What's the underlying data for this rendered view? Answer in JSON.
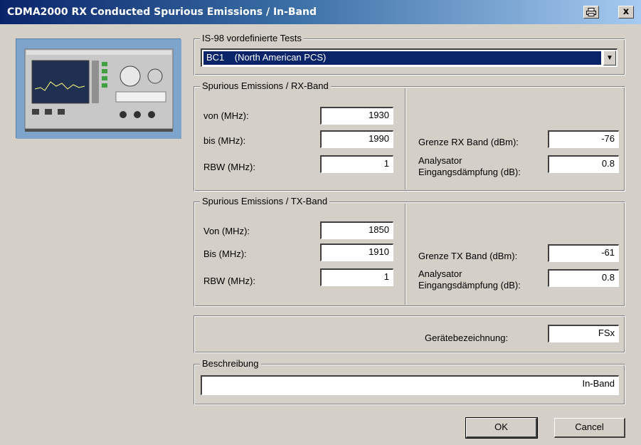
{
  "window": {
    "title": "CDMA2000  RX Conducted Spurious Emissions / In-Band",
    "print_icon": "printer-icon",
    "close_label": "x"
  },
  "preset": {
    "legend": "IS-98 vordefinierte Tests",
    "selected": "BC1    (North American PCS)"
  },
  "rx_band": {
    "legend": "Spurious Emissions / RX-Band",
    "from_label": "von (MHz):",
    "from_value": "1930",
    "to_label": "bis (MHz):",
    "to_value": "1990",
    "rbw_label": "RBW (MHz):",
    "rbw_value": "1",
    "limit_label": "Grenze RX Band (dBm):",
    "limit_value": "-76",
    "atten_label_1": "Analysator",
    "atten_label_2": "Eingangsdämpfung (dB):",
    "atten_value": "0.8"
  },
  "tx_band": {
    "legend": "Spurious Emissions / TX-Band",
    "from_label": "Von (MHz):",
    "from_value": "1850",
    "to_label": "Bis (MHz):",
    "to_value": "1910",
    "rbw_label": "RBW (MHz):",
    "rbw_value": "1",
    "limit_label": "Grenze TX Band (dBm):",
    "limit_value": "-61",
    "atten_label_1": "Analysator",
    "atten_label_2": "Eingangsdämpfung (dB):",
    "atten_value": "0.8"
  },
  "device": {
    "label": "Gerätebezeichnung:",
    "value": "FSx"
  },
  "description": {
    "legend": "Beschreibung",
    "value": "In-Band"
  },
  "buttons": {
    "ok": "OK",
    "cancel": "Cancel"
  }
}
